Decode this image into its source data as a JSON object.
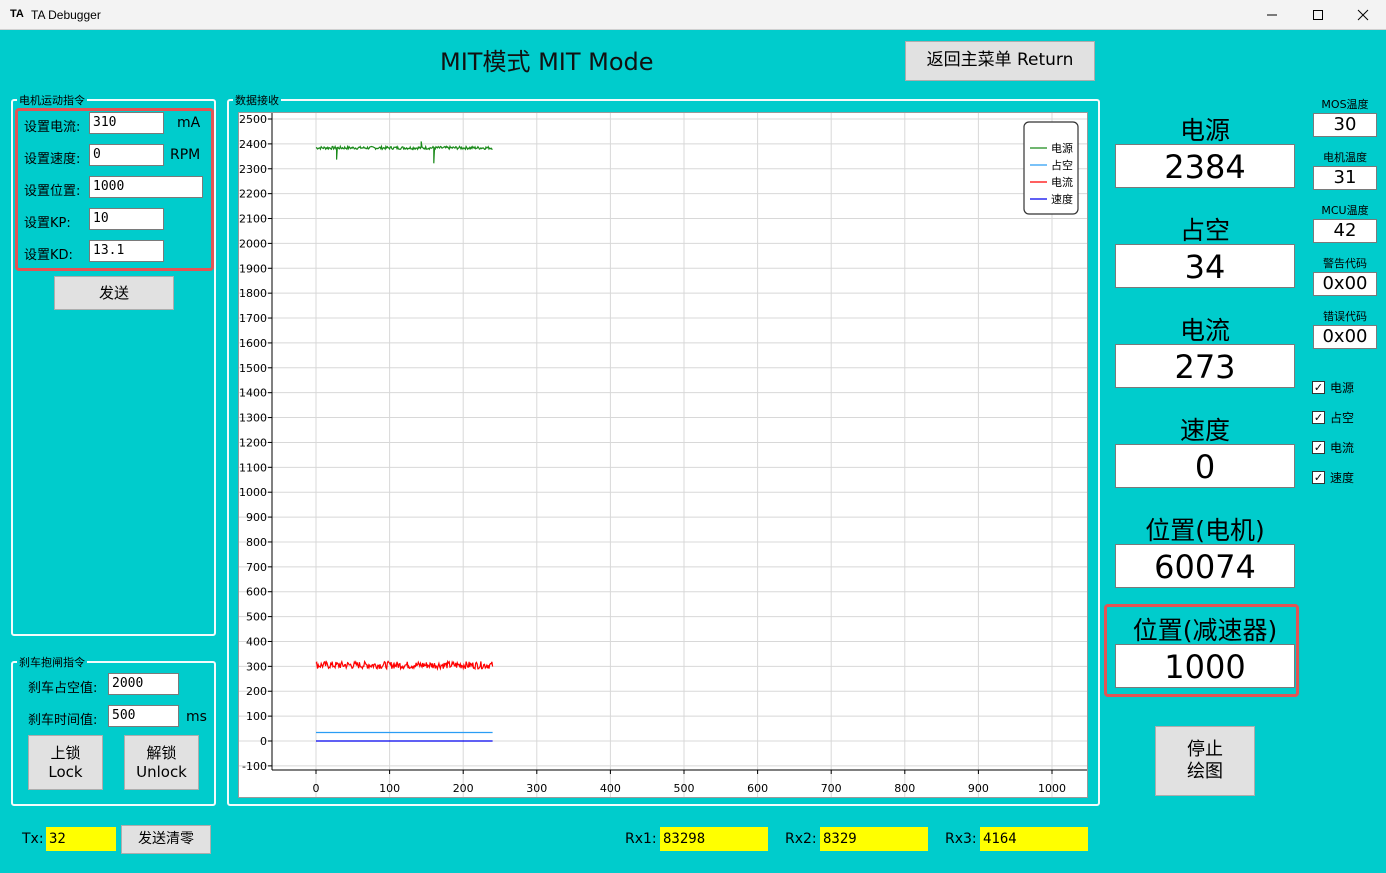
{
  "window": {
    "icon_text": "TA",
    "title": "TA Debugger"
  },
  "heading": "MIT模式 MIT Mode",
  "return_button": "返回主菜单 Return",
  "motion_group": {
    "title": "电机运动指令",
    "rows": [
      {
        "label": "设置电流:",
        "value": "310",
        "unit": "mA"
      },
      {
        "label": "设置速度:",
        "value": "0",
        "unit": "RPM"
      },
      {
        "label": "设置位置:",
        "value": "1000",
        "unit": ""
      },
      {
        "label": "设置KP:",
        "value": "10",
        "unit": ""
      },
      {
        "label": "设置KD:",
        "value": "13.1",
        "unit": ""
      }
    ],
    "send_button": "发送"
  },
  "brake_group": {
    "title": "刹车抱闸指令",
    "duty_label": "刹车占空值:",
    "duty_value": "2000",
    "time_label": "刹车时间值:",
    "time_value": "500",
    "time_unit": "ms",
    "lock_button": "上锁\nLock",
    "unlock_button": "解锁\nUnlock"
  },
  "data_group": {
    "title": "数据接收"
  },
  "chart_data": {
    "type": "line",
    "xlim": [
      0,
      1000
    ],
    "ylim": [
      -100,
      2500
    ],
    "x_ticks": [
      "0",
      "100",
      "200",
      "300",
      "400",
      "500",
      "600",
      "700",
      "800",
      "900",
      "1000"
    ],
    "y_ticks": [
      "-100",
      "0",
      "100",
      "200",
      "300",
      "400",
      "500",
      "600",
      "700",
      "800",
      "900",
      "1000",
      "1100",
      "1200",
      "1300",
      "1400",
      "1500",
      "1600",
      "1700",
      "1800",
      "1900",
      "2000",
      "2100",
      "2200",
      "2300",
      "2400",
      "2500"
    ],
    "grid": true,
    "legend_position": "top-right",
    "series": [
      {
        "name": "电源",
        "color": "#1a8a1a",
        "x_start": 0,
        "x_end": 240,
        "level": 2384,
        "noise": 6,
        "spikes": [
          {
            "x": 28,
            "y": 2337
          },
          {
            "x": 143,
            "y": 2410
          },
          {
            "x": 160,
            "y": 2322
          }
        ]
      },
      {
        "name": "占空",
        "color": "#2a9df4",
        "x_start": 0,
        "x_end": 240,
        "level": 34,
        "noise": 0,
        "spikes": []
      },
      {
        "name": "电流",
        "color": "#ff0000",
        "x_start": 0,
        "x_end": 240,
        "level": 305,
        "noise": 15,
        "spikes": []
      },
      {
        "name": "速度",
        "color": "#0000ee",
        "x_start": 0,
        "x_end": 240,
        "level": 0,
        "noise": 0,
        "spikes": []
      }
    ]
  },
  "readouts": [
    {
      "label": "电源",
      "value": "2384"
    },
    {
      "label": "占空",
      "value": "34"
    },
    {
      "label": "电流",
      "value": "273"
    },
    {
      "label": "速度",
      "value": "0"
    },
    {
      "label": "位置(电机)",
      "value": "60074"
    },
    {
      "label": "位置(减速器)",
      "value": "1000"
    }
  ],
  "small_readouts": [
    {
      "label": "MOS温度",
      "value": "30"
    },
    {
      "label": "电机温度",
      "value": "31"
    },
    {
      "label": "MCU温度",
      "value": "42"
    },
    {
      "label": "警告代码",
      "value": "0x00"
    },
    {
      "label": "错误代码",
      "value": "0x00"
    }
  ],
  "checkboxes": [
    {
      "label": "电源",
      "checked": true
    },
    {
      "label": "占空",
      "checked": true
    },
    {
      "label": "电流",
      "checked": true
    },
    {
      "label": "速度",
      "checked": true
    }
  ],
  "stop_button": "停止\n绘图",
  "bottom": {
    "tx_label": "Tx:",
    "tx_value": "32",
    "clear_button": "发送清零",
    "rx1_label": "Rx1:",
    "rx1_value": "83298",
    "rx2_label": "Rx2:",
    "rx2_value": "8329",
    "rx3_label": "Rx3:",
    "rx3_value": "4164"
  },
  "colors": {
    "background": "#00cccc",
    "highlight_border": "#e25454",
    "counter_bg": "#ffff00"
  }
}
